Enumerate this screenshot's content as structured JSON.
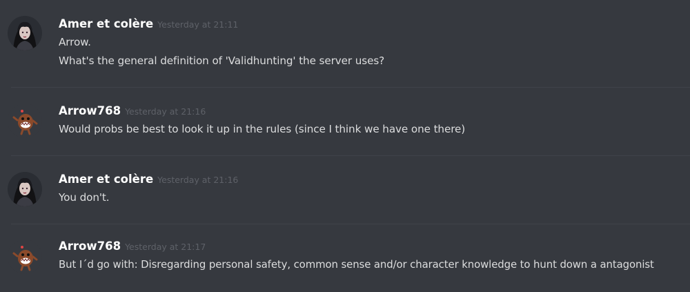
{
  "colors": {
    "background": "#36393f",
    "username": "#ffffff",
    "timestamp": "#5e6168",
    "message_text": "#dcddde",
    "divider": "#40434a"
  },
  "messages": [
    {
      "author": "Amer et colère",
      "avatar_icon": "gothic-woman-avatar",
      "timestamp": "Yesterday at 21:11",
      "lines": [
        "Arrow.",
        "What's the general definition of 'Validhunting' the server uses?"
      ]
    },
    {
      "author": "Arrow768",
      "avatar_icon": "domo-monster-avatar",
      "timestamp": "Yesterday at 21:16",
      "lines": [
        "Would probs be best to look it up in the rules (since I think we have one there)"
      ]
    },
    {
      "author": "Amer et colère",
      "avatar_icon": "gothic-woman-avatar",
      "timestamp": "Yesterday at 21:16",
      "lines": [
        "You don't."
      ]
    },
    {
      "author": "Arrow768",
      "avatar_icon": "domo-monster-avatar",
      "timestamp": "Yesterday at 21:17",
      "lines": [
        "But I´d go with: Disregarding personal safety, common sense and/or character knowledge to hunt down a antagonist"
      ]
    }
  ]
}
